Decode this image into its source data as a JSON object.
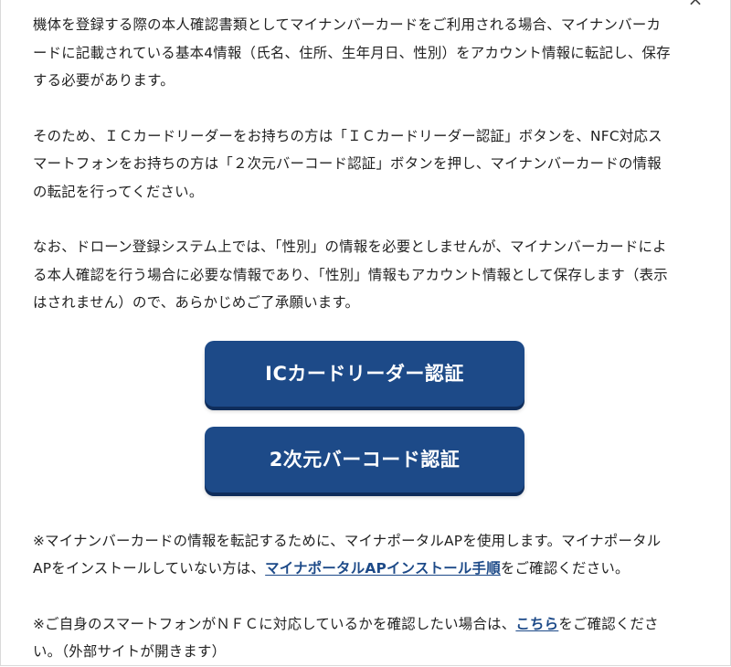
{
  "modal": {
    "close_glyph": "×"
  },
  "paragraphs": {
    "intro_line1": "機体を登録する際の本人確認書類としてマイナンバーカードをご利用される場合、マイナンバーカ",
    "intro_line2": "ードに記載されている基本4情報（氏名、住所、生年月日、性別）をアカウント情報に転記し、保存",
    "intro_line3": "する必要があります。",
    "method_line1": "そのため、ＩＣカードリーダーをお持ちの方は「ＩＣカードリーダー認証」ボタンを、NFC対応ス",
    "method_line2": "マートフォンをお持ちの方は「２次元バーコード認証」ボタンを押し、マイナンバーカードの情報",
    "method_line3": "の転記を行ってください。",
    "gender_line1": "なお、ドローン登録システム上では、「性別」の情報を必要としませんが、マイナンバーカードによ",
    "gender_line2": "る本人確認を行う場合に必要な情報であり、「性別」情報もアカウント情報として保存します（表示",
    "gender_line3": "はされません）ので、あらかじめご了承願います。"
  },
  "buttons": {
    "ic_reader": "ICカードリーダー認証",
    "qr_code": "2次元バーコード認証"
  },
  "notes": {
    "portal_line1": "※マイナンバーカードの情報を転記するために、マイナポータルAPを使用します。マイナポータル",
    "portal_line2_prefix": "APをインストールしていない方は、",
    "portal_link": "マイナポータルAPインストール手順",
    "portal_line2_suffix": "をご確認ください。",
    "nfc_line1_prefix": "※ご自身のスマートフォンがＮＦＣに対応しているかを確認したい場合は、",
    "nfc_link": "こちら",
    "nfc_line1_suffix": "をご確認くださ",
    "nfc_line2": "い。（外部サイトが開きます）"
  },
  "colors": {
    "button_bg": "#1d4a88",
    "link": "#1d4a88",
    "text": "#222222"
  }
}
